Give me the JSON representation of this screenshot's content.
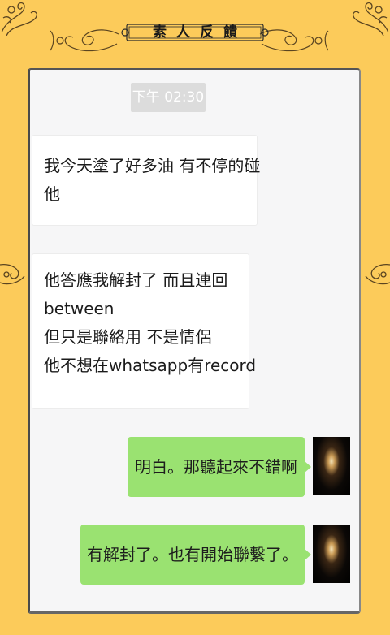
{
  "header": {
    "title": "素人反饋"
  },
  "chat": {
    "timestamp": "下午 02:30",
    "messages": [
      {
        "direction": "incoming",
        "lines": [
          "我今天塗了好多油 有不停的碰",
          "他"
        ]
      },
      {
        "direction": "incoming",
        "lines": [
          "他答應我解封了 而且連回",
          "between",
          "但只是聯絡用 不是情侶",
          "他不想在whatsapp有record"
        ]
      },
      {
        "direction": "outgoing",
        "text": "明白。那聽起來不錯啊"
      },
      {
        "direction": "outgoing",
        "text": "有解封了。也有開始聯繫了。"
      }
    ]
  },
  "colors": {
    "background": "#fccb5a",
    "panel": "#f6f6f7",
    "outgoing_bubble": "#9ae271",
    "incoming_bubble": "#ffffff",
    "timestamp_bg": "#dcdcdc"
  },
  "icons": [
    "decorative-swirl-icon",
    "candle-avatar-icon"
  ]
}
